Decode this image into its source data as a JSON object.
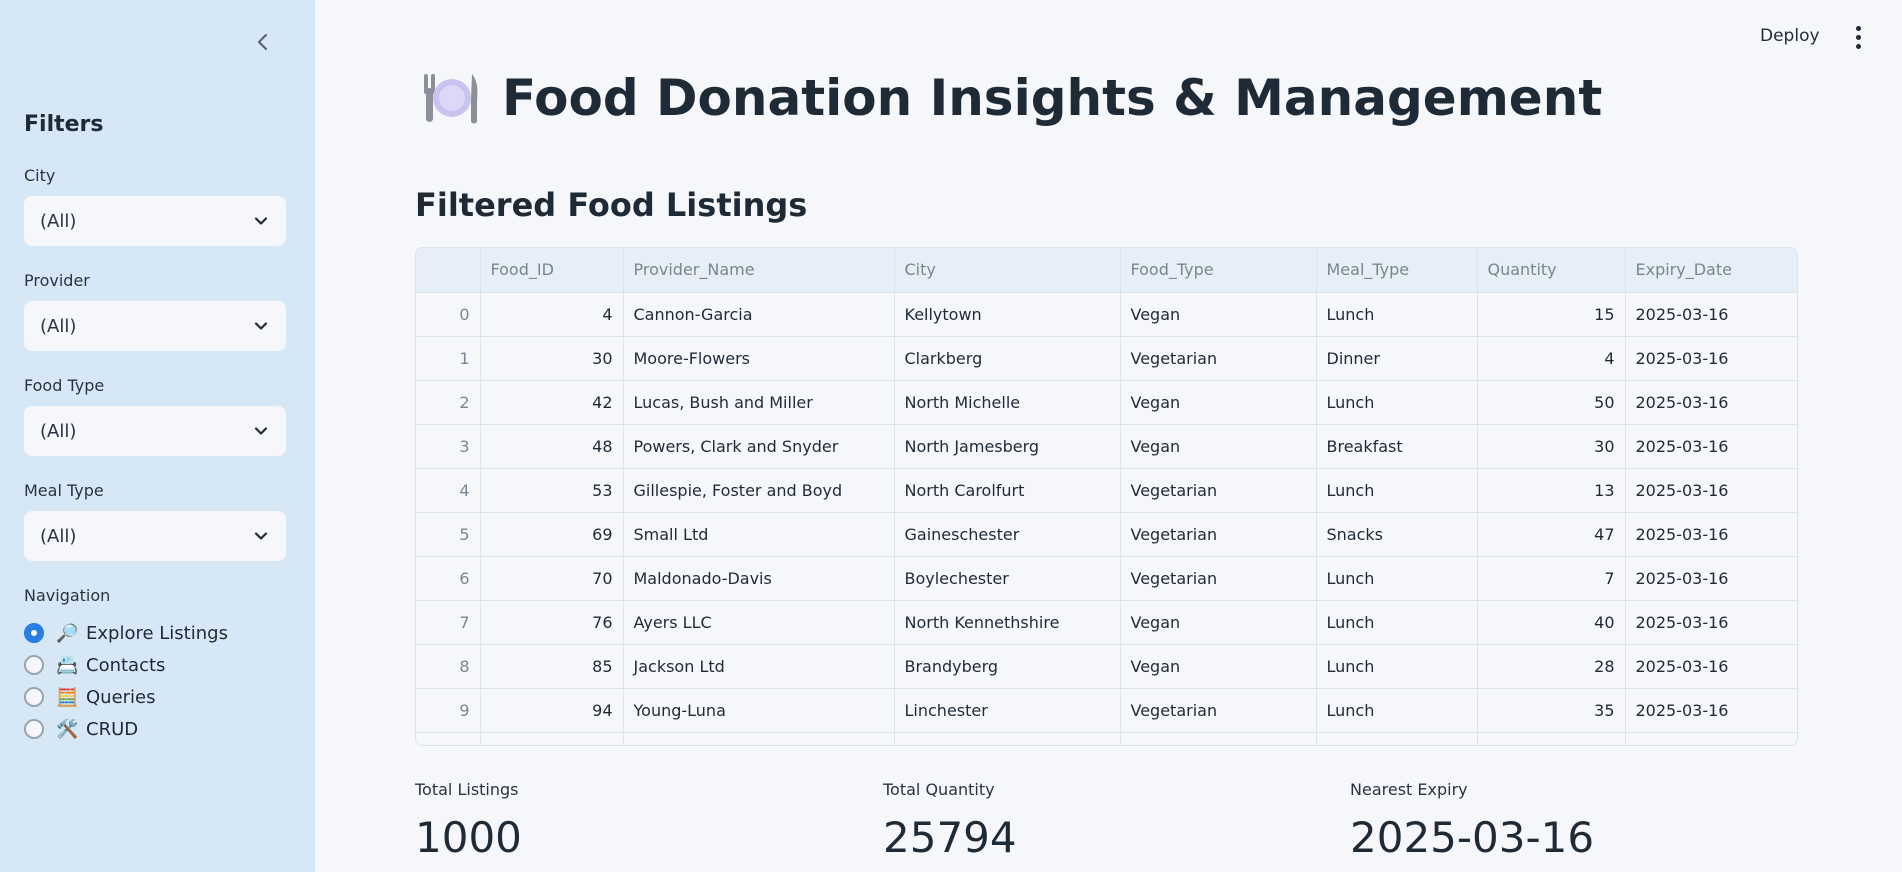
{
  "sidebar": {
    "title": "Filters",
    "filters": [
      {
        "label": "City",
        "value": "(All)"
      },
      {
        "label": "Provider",
        "value": "(All)"
      },
      {
        "label": "Food Type",
        "value": "(All)"
      },
      {
        "label": "Meal Type",
        "value": "(All)"
      }
    ],
    "navigation": {
      "label": "Navigation",
      "items": [
        {
          "emoji": "🔎",
          "label": "Explore Listings",
          "selected": true
        },
        {
          "emoji": "📇",
          "label": "Contacts",
          "selected": false
        },
        {
          "emoji": "🧮",
          "label": "Queries",
          "selected": false
        },
        {
          "emoji": "🛠️",
          "label": "CRUD",
          "selected": false
        }
      ]
    }
  },
  "header": {
    "deploy_label": "Deploy"
  },
  "main": {
    "title": "Food Donation Insights & Management",
    "section_title": "Filtered Food Listings",
    "table": {
      "columns": [
        "",
        "Food_ID",
        "Provider_Name",
        "City",
        "Food_Type",
        "Meal_Type",
        "Quantity",
        "Expiry_Date"
      ],
      "rows": [
        [
          "0",
          "4",
          "Cannon-Garcia",
          "Kellytown",
          "Vegan",
          "Lunch",
          "15",
          "2025-03-16"
        ],
        [
          "1",
          "30",
          "Moore-Flowers",
          "Clarkberg",
          "Vegetarian",
          "Dinner",
          "4",
          "2025-03-16"
        ],
        [
          "2",
          "42",
          "Lucas, Bush and Miller",
          "North Michelle",
          "Vegan",
          "Lunch",
          "50",
          "2025-03-16"
        ],
        [
          "3",
          "48",
          "Powers, Clark and Snyder",
          "North Jamesberg",
          "Vegan",
          "Breakfast",
          "30",
          "2025-03-16"
        ],
        [
          "4",
          "53",
          "Gillespie, Foster and Boyd",
          "North Carolfurt",
          "Vegetarian",
          "Lunch",
          "13",
          "2025-03-16"
        ],
        [
          "5",
          "69",
          "Small Ltd",
          "Gaineschester",
          "Vegetarian",
          "Snacks",
          "47",
          "2025-03-16"
        ],
        [
          "6",
          "70",
          "Maldonado-Davis",
          "Boylechester",
          "Vegetarian",
          "Lunch",
          "7",
          "2025-03-16"
        ],
        [
          "7",
          "76",
          "Ayers LLC",
          "North Kennethshire",
          "Vegan",
          "Lunch",
          "40",
          "2025-03-16"
        ],
        [
          "8",
          "85",
          "Jackson Ltd",
          "Brandyberg",
          "Vegan",
          "Lunch",
          "28",
          "2025-03-16"
        ],
        [
          "9",
          "94",
          "Young-Luna",
          "Linchester",
          "Vegetarian",
          "Lunch",
          "35",
          "2025-03-16"
        ]
      ]
    },
    "metrics": [
      {
        "label": "Total Listings",
        "value": "1000"
      },
      {
        "label": "Total Quantity",
        "value": "25794"
      },
      {
        "label": "Nearest Expiry",
        "value": "2025-03-16"
      }
    ]
  },
  "colors": {
    "accent": "#2a7de1",
    "sidebar_bg": "#d6e8f6",
    "page_bg": "#f5f7fa",
    "header_row_bg": "#e6eff8"
  }
}
